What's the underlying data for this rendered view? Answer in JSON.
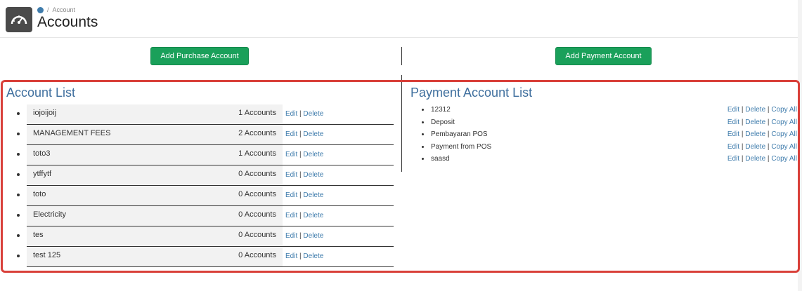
{
  "header": {
    "breadcrumb": "Account",
    "title": "Accounts"
  },
  "buttons": {
    "add_purchase": "Add Purchase Account",
    "add_payment": "Add Payment Account"
  },
  "account_list": {
    "title": "Account List",
    "edit_label": "Edit",
    "delete_label": "Delete",
    "items": [
      {
        "name": "iojoijoij",
        "count": "1 Accounts"
      },
      {
        "name": "MANAGEMENT FEES",
        "count": "2 Accounts"
      },
      {
        "name": "toto3",
        "count": "1 Accounts"
      },
      {
        "name": "ytffytf",
        "count": "0 Accounts"
      },
      {
        "name": "toto",
        "count": "0 Accounts"
      },
      {
        "name": "Electricity",
        "count": "0 Accounts"
      },
      {
        "name": "tes",
        "count": "0 Accounts"
      },
      {
        "name": "test 125",
        "count": "0 Accounts"
      }
    ]
  },
  "payment_list": {
    "title": "Payment Account List",
    "edit_label": "Edit",
    "delete_label": "Delete",
    "copy_label": "Copy All",
    "items": [
      {
        "name": "12312"
      },
      {
        "name": "Deposit"
      },
      {
        "name": "Pembayaran POS"
      },
      {
        "name": "Payment from POS"
      },
      {
        "name": "saasd"
      }
    ]
  },
  "colors": {
    "accent_green": "#1aa05a",
    "title_blue": "#3f6f9e",
    "link_blue": "#3f7cac",
    "highlight_red": "#d9403a"
  },
  "icons": {
    "header": "dashboard-gauge-icon",
    "breadcrumb": "home-icon"
  }
}
